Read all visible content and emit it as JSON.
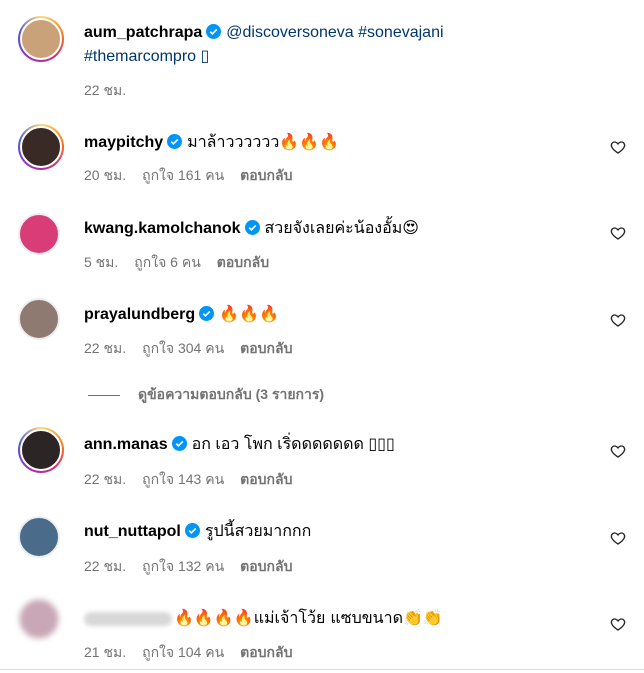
{
  "caption": {
    "username": "aum_patchrapa",
    "text_line1": "@discoversoneva #sonevajani",
    "text_line2": "#themarcompro ▯",
    "time": "22 ชม.",
    "avatar_color": "#c9a27a"
  },
  "comments": [
    {
      "username": "maypitchy",
      "text": "มาล้าวววววว🔥🔥🔥",
      "time": "20 ชม.",
      "likes": "ถูกใจ 161 คน",
      "reply": "ตอบกลับ",
      "avatar_color": "#3a2a26"
    },
    {
      "username": "kwang.kamolchanok",
      "text": "สวยจังเลยค่ะน้องอั้ม😍",
      "time": "5 ชม.",
      "likes": "ถูกใจ 6 คน",
      "reply": "ตอบกลับ",
      "avatar_color": "#d93d78"
    },
    {
      "username": "prayalundberg",
      "text": "🔥🔥🔥",
      "time": "22 ชม.",
      "likes": "ถูกใจ 304 คน",
      "reply": "ตอบกลับ",
      "avatar_color": "#8f7a72"
    },
    {
      "username": "ann.manas",
      "text": "อก เอว โพก เริ่ดดดดดดด ▯▯▯",
      "time": "22 ชม.",
      "likes": "ถูกใจ 143 คน",
      "reply": "ตอบกลับ",
      "avatar_color": "#2b2525"
    },
    {
      "username": "nut_nuttapol",
      "text": "รูปนี้สวยมากกก",
      "time": "22 ชม.",
      "likes": "ถูกใจ 132 คน",
      "reply": "ตอบกลับ",
      "avatar_color": "#4a6b8a"
    },
    {
      "username": "",
      "text": "🔥🔥🔥🔥แม่เจ้าโว้ย แซบขนาด👏👏",
      "time": "21 ชม.",
      "likes": "ถูกใจ 104 คน",
      "reply": "ตอบกลับ",
      "avatar_color": "#c9a7b6"
    }
  ],
  "view_replies": "ดูข้อความตอบกลับ (3 รายการ)",
  "colors": {
    "verified": "#0095f6",
    "secondary_text": "#737373",
    "link": "#00376b"
  },
  "icons": {
    "verified": "verified-badge-icon",
    "like": "heart-outline-icon"
  }
}
